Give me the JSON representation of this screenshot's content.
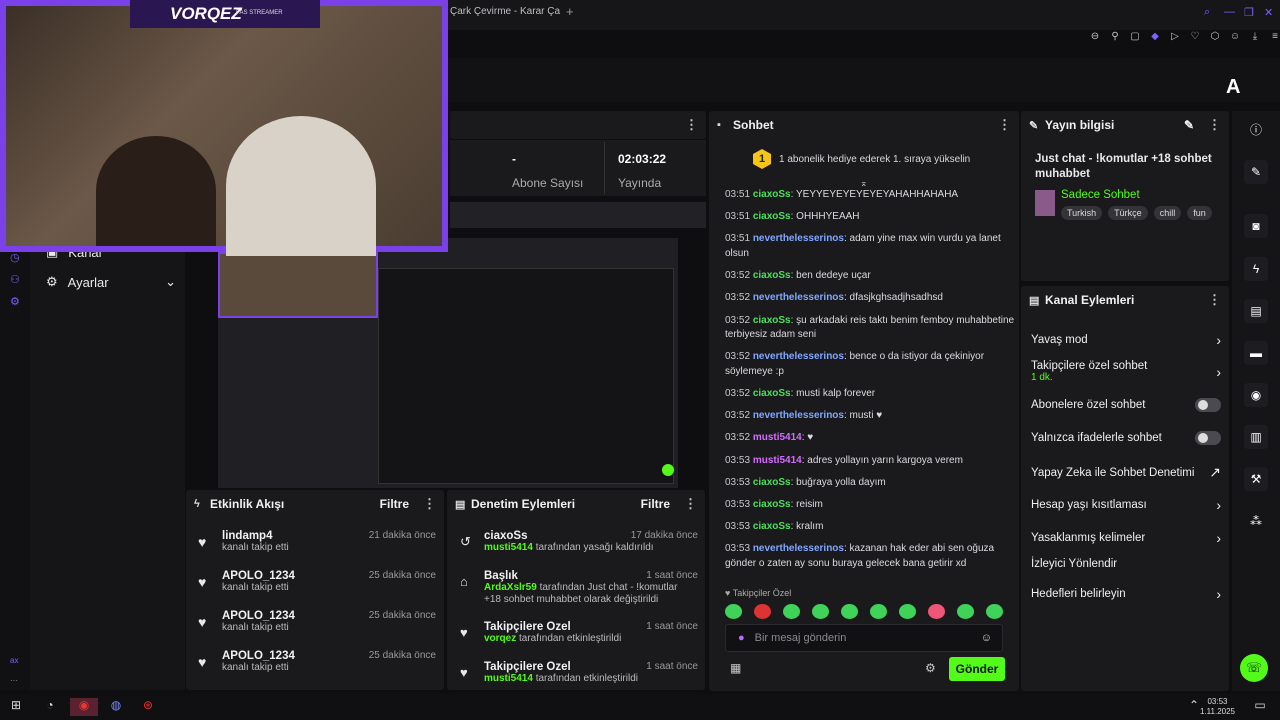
{
  "browser": {
    "tab_title": "Çark Çevirme - Karar Ça",
    "plus": "+"
  },
  "header": {
    "logo": "A"
  },
  "stream": {
    "brand": "VORQEZ",
    "brand_sub": "PAS STREAMER"
  },
  "stats": {
    "abone_val": "-",
    "abone_label": "Abone Sayısı",
    "yayinda_val": "02:03:22",
    "yayinda_label": "Yayında"
  },
  "sidebar": {
    "items": [
      {
        "label": "Kanal"
      },
      {
        "label": "Ayarlar"
      }
    ]
  },
  "chat": {
    "title": "Sohbet",
    "banner_rank": "1",
    "banner_text": "1 abonelik hediye ederek 1. sıraya yükselin",
    "messages": [
      {
        "time": "03:51",
        "user": "ciaxoSs",
        "text": ": YEYYEYEYEYEYEYAHAHHAHAHA",
        "color": "g"
      },
      {
        "time": "03:51",
        "user": "ciaxoSs",
        "text": ": OHHHYEAAH",
        "color": "g"
      },
      {
        "time": "03:51",
        "user": "neverthelesserinos",
        "text": ": adam yine max win vurdu ya lanet olsun",
        "color": "b"
      },
      {
        "time": "03:52",
        "user": "ciaxoSs",
        "text": ": ben dedeye uçar",
        "color": "g"
      },
      {
        "time": "03:52",
        "user": "neverthelesserinos",
        "text": ": dfasjkghsadjhsadhsd",
        "color": "b"
      },
      {
        "time": "03:52",
        "user": "ciaxoSs",
        "text": ": şu arkadaki reis taktı benim femboy muhabbetine terbiyesiz adam seni",
        "color": "g"
      },
      {
        "time": "03:52",
        "user": "neverthelesserinos",
        "text": ": bence o da istiyor da çekiniyor söylemeye :p",
        "color": "b"
      },
      {
        "time": "03:52",
        "user": "ciaxoSs",
        "text": ": musti kalp forever",
        "color": "g"
      },
      {
        "time": "03:52",
        "user": "neverthelesserinos",
        "text": ": musti ♥",
        "color": "b"
      },
      {
        "time": "03:52",
        "user": "musti5414",
        "text": ": ♥",
        "color": "p"
      },
      {
        "time": "03:53",
        "user": "musti5414",
        "text": ": adres yollayın yarın kargoya verem",
        "color": "p"
      },
      {
        "time": "03:53",
        "user": "ciaxoSs",
        "text": ": buğraya yolla dayım",
        "color": "g"
      },
      {
        "time": "03:53",
        "user": "ciaxoSs",
        "text": ": reisim",
        "color": "g"
      },
      {
        "time": "03:53",
        "user": "ciaxoSs",
        "text": ": kralım",
        "color": "g"
      },
      {
        "time": "03:53",
        "user": "neverthelesserinos",
        "text": ": kazanan hak eder abi sen oğuza gönder o zaten ay sonu buraya gelecek bana getirir xd",
        "color": "b"
      }
    ],
    "followers_only": "Takipçiler Özel",
    "input_placeholder": "Bir mesaj gönderin",
    "send_label": "Gönder"
  },
  "info": {
    "title": "Yayın bilgisi",
    "stream_title": "Just chat - !komutlar +18 sohbet muhabbet",
    "category": "Sadece Sohbet",
    "tags": [
      "Turkish",
      "Türkçe",
      "chill",
      "fun"
    ]
  },
  "kanal": {
    "title": "Kanal Eylemleri",
    "items": [
      {
        "label": "Yavaş mod",
        "sub": "",
        "ctrl": "›"
      },
      {
        "label": "Takipçilere özel sohbet",
        "sub": "1 dk.",
        "ctrl": "›"
      },
      {
        "label": "Abonelere özel sohbet",
        "sub": "",
        "ctrl": "toggle"
      },
      {
        "label": "Yalnızca ifadelerle sohbet",
        "sub": "",
        "ctrl": "toggle"
      },
      {
        "label": "Yapay Zeka ile Sohbet Denetimi",
        "sub": "",
        "ctrl": "↗"
      },
      {
        "label": "Hesap yaşı kısıtlaması",
        "sub": "",
        "ctrl": "›"
      },
      {
        "label": "Yasaklanmış kelimeler",
        "sub": "",
        "ctrl": "›"
      },
      {
        "label": "İzleyici Yönlendir",
        "sub": "",
        "ctrl": ""
      },
      {
        "label": "Hedefleri belirleyin",
        "sub": "",
        "ctrl": "›"
      }
    ]
  },
  "etkinlik": {
    "title": "Etkinlik Akışı",
    "filter": "Filtre",
    "items": [
      {
        "name": "lindamp4",
        "sub": "kanalı takip etti",
        "time": "21 dakika önce"
      },
      {
        "name": "APOLO_1234",
        "sub": "kanalı takip etti",
        "time": "25 dakika önce"
      },
      {
        "name": "APOLO_1234",
        "sub": "kanalı takip etti",
        "time": "25 dakika önce"
      },
      {
        "name": "APOLO_1234",
        "sub": "kanalı takip etti",
        "time": "25 dakika önce"
      }
    ]
  },
  "denetim": {
    "title": "Denetim Eylemleri",
    "filter": "Filtre",
    "items": [
      {
        "name": "ciaxoSs",
        "time": "17 dakika önce",
        "actor": "musti5414",
        "rest": " tarafından yasağı kaldırıldı"
      },
      {
        "name": "Başlık",
        "time": "1 saat önce",
        "actor": "ArdaXslr59",
        "rest": " tarafından Just chat - !komutlar +18 sohbet muhabbet olarak değiştirildi"
      },
      {
        "name": "Takipçilere Özel",
        "time": "1 saat önce",
        "actor": "vorqez",
        "rest": " tarafından etkinleştirildi"
      },
      {
        "name": "Takipçilere Özel",
        "time": "1 saat önce",
        "actor": "musti5414",
        "rest": " tarafından etkinleştirildi"
      }
    ]
  },
  "taskbar": {
    "time": "03:53",
    "date": "1.11.2025"
  }
}
